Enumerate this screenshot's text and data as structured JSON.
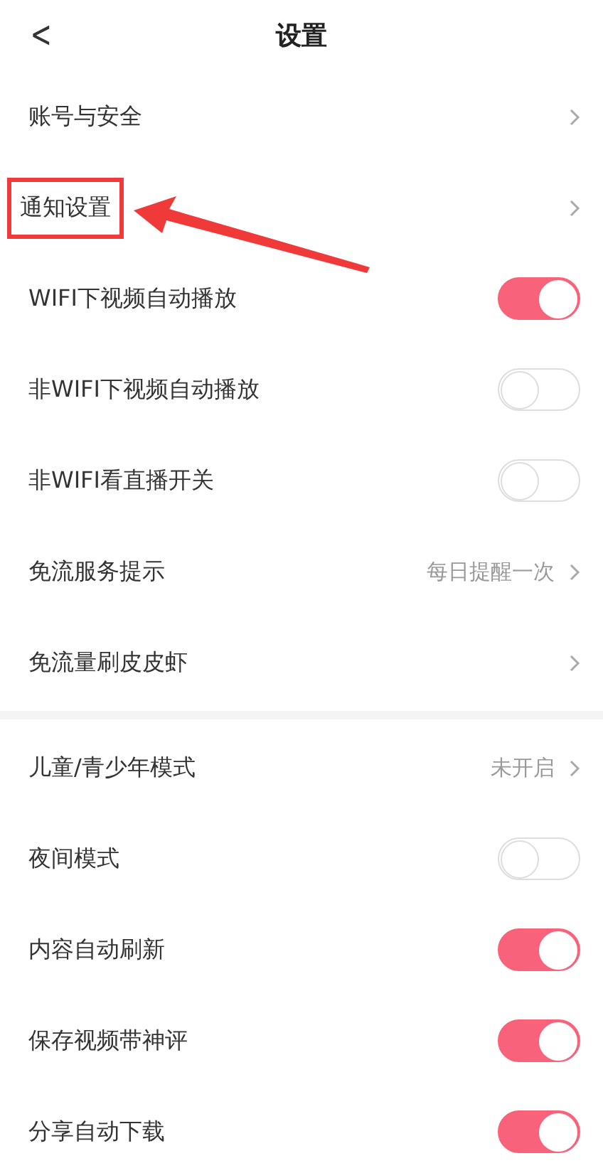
{
  "header": {
    "back": "<",
    "title": "设置"
  },
  "sections": [
    {
      "rows": [
        {
          "kind": "link",
          "label": "账号与安全",
          "highlighted": false
        },
        {
          "kind": "link",
          "label": "通知设置",
          "highlighted": true
        },
        {
          "kind": "toggle",
          "label": "WIFI下视频自动播放",
          "on": true
        },
        {
          "kind": "toggle",
          "label": "非WIFI下视频自动播放",
          "on": false
        },
        {
          "kind": "toggle",
          "label": "非WIFI看直播开关",
          "on": false
        },
        {
          "kind": "link",
          "label": "免流服务提示",
          "value": "每日提醒一次",
          "highlighted": false
        },
        {
          "kind": "link",
          "label": "免流量刷皮皮虾",
          "highlighted": false
        }
      ]
    },
    {
      "rows": [
        {
          "kind": "link",
          "label": "儿童/青少年模式",
          "value": "未开启",
          "highlighted": false
        },
        {
          "kind": "toggle",
          "label": "夜间模式",
          "on": false
        },
        {
          "kind": "toggle",
          "label": "内容自动刷新",
          "on": true
        },
        {
          "kind": "toggle",
          "label": "保存视频带神评",
          "on": true
        },
        {
          "kind": "toggle",
          "label": "分享自动下载",
          "on": true
        }
      ]
    }
  ]
}
